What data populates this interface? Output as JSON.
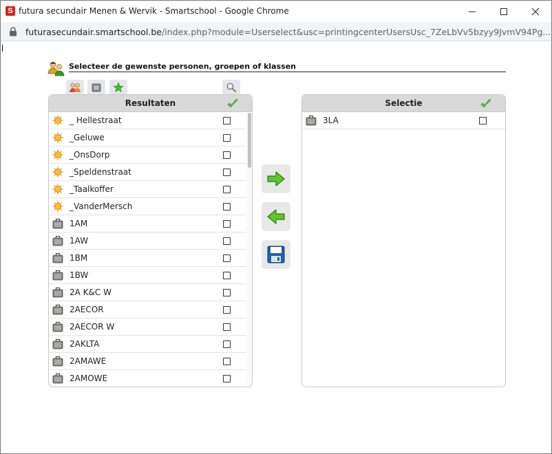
{
  "window": {
    "title": "futura secundair Menen & Wervik - Smartschool - Google Chrome",
    "app_icon_letter": "S"
  },
  "address_bar": {
    "host": "futurasecundair.smartschool.be",
    "path": "/index.php?module=Userselect&usc=printingcenterUsersUsc_7ZeLbVv5bzyy9JvmV94Pg..."
  },
  "header": {
    "title": "Selecteer de gewenste personen, groepen of klassen"
  },
  "results_panel": {
    "title": "Resultaten",
    "rows": [
      {
        "label": "_ Hellestraat",
        "icon": "sun-icon"
      },
      {
        "label": "_Geluwe",
        "icon": "sun-icon"
      },
      {
        "label": "_OnsDorp",
        "icon": "sun-icon"
      },
      {
        "label": "_Speldenstraat",
        "icon": "sun-icon"
      },
      {
        "label": "_Taalkoffer",
        "icon": "sun-icon"
      },
      {
        "label": "_VanderMersch",
        "icon": "sun-icon"
      },
      {
        "label": "1AM",
        "icon": "briefcase-icon"
      },
      {
        "label": "1AW",
        "icon": "briefcase-icon"
      },
      {
        "label": "1BM",
        "icon": "briefcase-icon"
      },
      {
        "label": "1BW",
        "icon": "briefcase-icon"
      },
      {
        "label": "2A K&C W",
        "icon": "briefcase-icon"
      },
      {
        "label": "2AECOR",
        "icon": "briefcase-icon"
      },
      {
        "label": "2AECOR W",
        "icon": "briefcase-icon"
      },
      {
        "label": "2AKLTA",
        "icon": "briefcase-icon"
      },
      {
        "label": "2AMAWE",
        "icon": "briefcase-icon"
      },
      {
        "label": "2AMOWE",
        "icon": "briefcase-icon"
      }
    ]
  },
  "selection_panel": {
    "title": "Selectie",
    "rows": [
      {
        "label": "3LA",
        "icon": "briefcase-icon"
      }
    ]
  },
  "colors": {
    "panel_header": "#d9d9d9",
    "arrow_green": "#5cc82a",
    "save_blue": "#1f5fb0"
  }
}
